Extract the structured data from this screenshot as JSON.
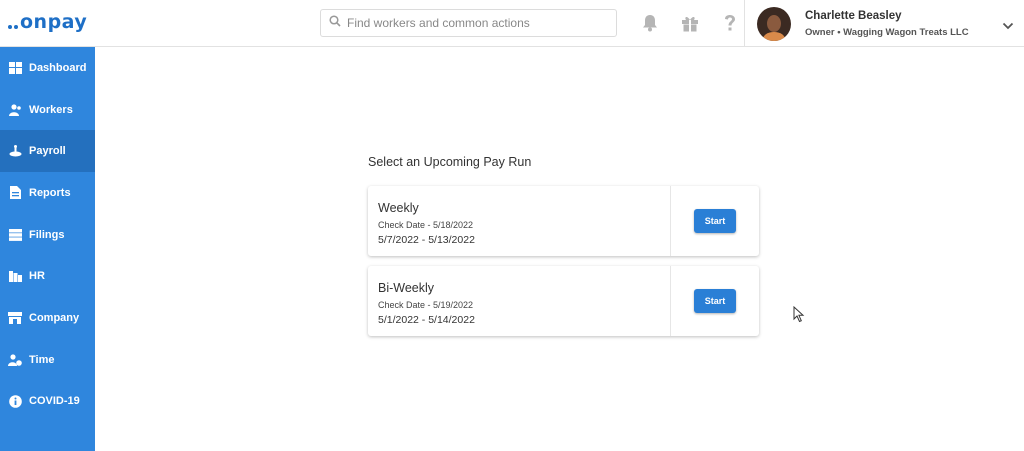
{
  "logo": {
    "text": "onpay"
  },
  "search": {
    "placeholder": "Find workers and common actions",
    "icon": "search-icon"
  },
  "header_icons": [
    "bell-icon",
    "gift-icon",
    "help-icon"
  ],
  "user": {
    "name": "Charlette Beasley",
    "subtitle": "Owner • Wagging Wagon Treats LLC"
  },
  "sidebar": {
    "items": [
      {
        "label": "Dashboard",
        "icon": "dashboard-icon",
        "active": false
      },
      {
        "label": "Workers",
        "icon": "workers-icon",
        "active": false
      },
      {
        "label": "Payroll",
        "icon": "payroll-icon",
        "active": true
      },
      {
        "label": "Reports",
        "icon": "reports-icon",
        "active": false
      },
      {
        "label": "Filings",
        "icon": "filings-icon",
        "active": false
      },
      {
        "label": "HR",
        "icon": "hr-icon",
        "active": false
      },
      {
        "label": "Company",
        "icon": "company-icon",
        "active": false
      },
      {
        "label": "Time",
        "icon": "time-icon",
        "active": false
      },
      {
        "label": "COVID-19",
        "icon": "info-icon",
        "active": false
      }
    ]
  },
  "main": {
    "title": "Select an Upcoming Pay Run",
    "pay_runs": [
      {
        "name": "Weekly",
        "check_date": "Check Date - 5/18/2022",
        "range": "5/7/2022 - 5/13/2022",
        "button": "Start"
      },
      {
        "name": "Bi-Weekly",
        "check_date": "Check Date - 5/19/2022",
        "range": "5/1/2022 - 5/14/2022",
        "button": "Start"
      }
    ]
  },
  "colors": {
    "sidebar": "#2f86dd",
    "sidebar_active": "#2470be",
    "brand": "#1e6fc6",
    "button": "#2a7fd6"
  }
}
